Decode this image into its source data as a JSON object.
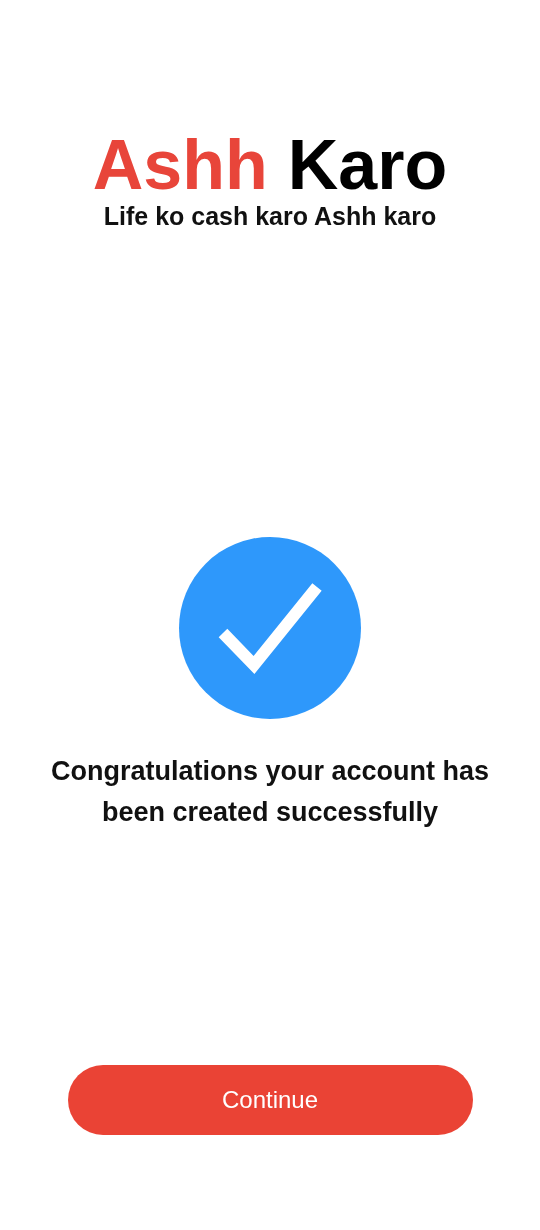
{
  "logo": {
    "parts": [
      {
        "text": "Ashh",
        "color": "#e8453a"
      },
      {
        "text": "Karo",
        "color": "#000000"
      }
    ]
  },
  "tagline": "Life ko cash karo Ashh karo",
  "message": "Congratulations your account has been created successfully",
  "button": {
    "label": "Continue"
  }
}
